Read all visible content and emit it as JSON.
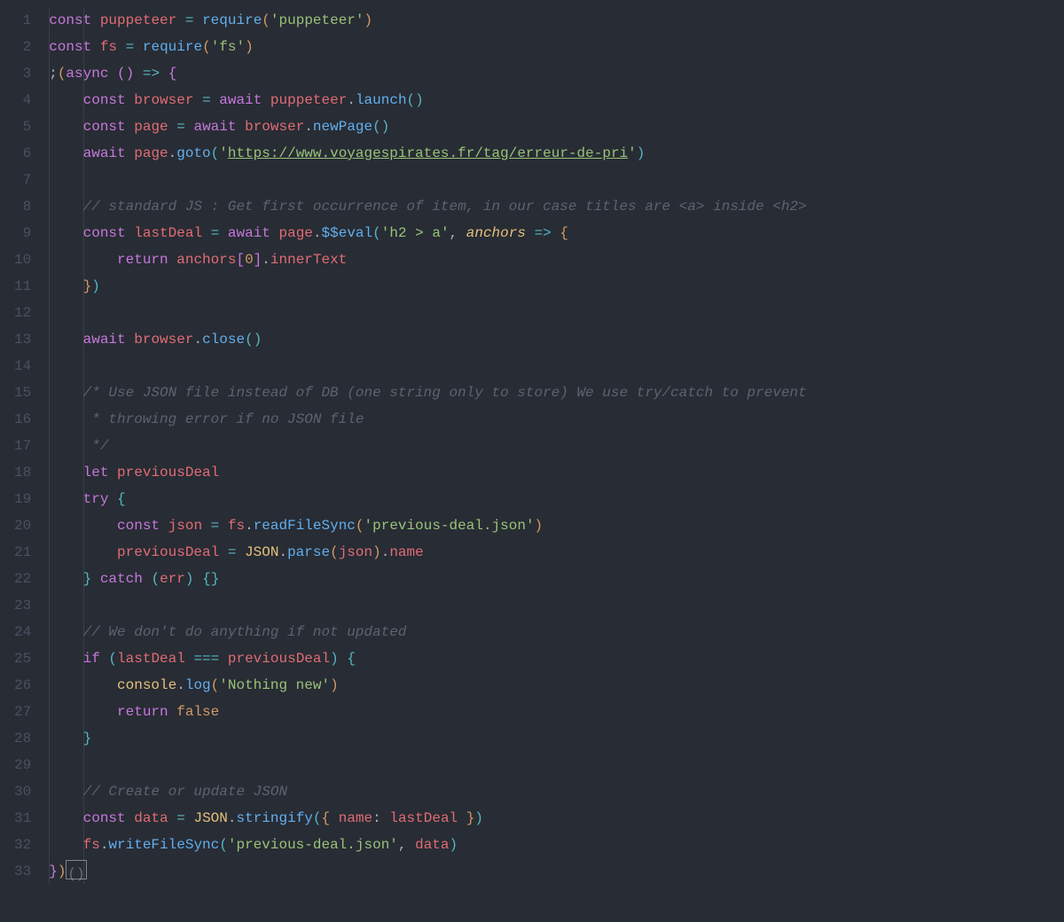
{
  "language": "javascript",
  "theme": "one-dark",
  "lineCount": 33,
  "tokens": {
    "l1": [
      [
        "kw",
        "const"
      ],
      [
        "pun",
        " "
      ],
      [
        "var",
        "puppeteer"
      ],
      [
        "pun",
        " "
      ],
      [
        "op",
        "="
      ],
      [
        "pun",
        " "
      ],
      [
        "fn",
        "require"
      ],
      [
        "brk1",
        "("
      ],
      [
        "str",
        "'puppeteer'"
      ],
      [
        "brk1",
        ")"
      ]
    ],
    "l2": [
      [
        "kw",
        "const"
      ],
      [
        "pun",
        " "
      ],
      [
        "var",
        "fs"
      ],
      [
        "pun",
        " "
      ],
      [
        "op",
        "="
      ],
      [
        "pun",
        " "
      ],
      [
        "fn",
        "require"
      ],
      [
        "brk1",
        "("
      ],
      [
        "str",
        "'fs'"
      ],
      [
        "brk1",
        ")"
      ]
    ],
    "l3": [
      [
        "pun",
        ";"
      ],
      [
        "brk1",
        "("
      ],
      [
        "kw",
        "async"
      ],
      [
        "pun",
        " "
      ],
      [
        "brk2",
        "("
      ],
      [
        "brk2",
        ")"
      ],
      [
        "pun",
        " "
      ],
      [
        "op",
        "=>"
      ],
      [
        "pun",
        " "
      ],
      [
        "brk2",
        "{"
      ]
    ],
    "l4": [
      [
        "pun",
        "    "
      ],
      [
        "kw",
        "const"
      ],
      [
        "pun",
        " "
      ],
      [
        "var",
        "browser"
      ],
      [
        "pun",
        " "
      ],
      [
        "op",
        "="
      ],
      [
        "pun",
        " "
      ],
      [
        "kw",
        "await"
      ],
      [
        "pun",
        " "
      ],
      [
        "var",
        "puppeteer"
      ],
      [
        "pun",
        "."
      ],
      [
        "fn",
        "launch"
      ],
      [
        "brk3",
        "("
      ],
      [
        "brk3",
        ")"
      ]
    ],
    "l5": [
      [
        "pun",
        "    "
      ],
      [
        "kw",
        "const"
      ],
      [
        "pun",
        " "
      ],
      [
        "var",
        "page"
      ],
      [
        "pun",
        " "
      ],
      [
        "op",
        "="
      ],
      [
        "pun",
        " "
      ],
      [
        "kw",
        "await"
      ],
      [
        "pun",
        " "
      ],
      [
        "var",
        "browser"
      ],
      [
        "pun",
        "."
      ],
      [
        "fn",
        "newPage"
      ],
      [
        "brk3",
        "("
      ],
      [
        "brk3",
        ")"
      ]
    ],
    "l6": [
      [
        "pun",
        "    "
      ],
      [
        "kw",
        "await"
      ],
      [
        "pun",
        " "
      ],
      [
        "var",
        "page"
      ],
      [
        "pun",
        "."
      ],
      [
        "fn",
        "goto"
      ],
      [
        "brk3",
        "("
      ],
      [
        "str",
        "'"
      ],
      [
        "link",
        "https://www.voyagespirates.fr/tag/erreur-de-pri"
      ],
      [
        "str",
        "'"
      ],
      [
        "brk3",
        ")"
      ]
    ],
    "l7": [],
    "l8": [
      [
        "pun",
        "    "
      ],
      [
        "cmt",
        "// standard JS : Get first occurrence of item, in our case titles are <a> inside <h2>"
      ]
    ],
    "l9": [
      [
        "pun",
        "    "
      ],
      [
        "kw",
        "const"
      ],
      [
        "pun",
        " "
      ],
      [
        "var",
        "lastDeal"
      ],
      [
        "pun",
        " "
      ],
      [
        "op",
        "="
      ],
      [
        "pun",
        " "
      ],
      [
        "kw",
        "await"
      ],
      [
        "pun",
        " "
      ],
      [
        "var",
        "page"
      ],
      [
        "pun",
        "."
      ],
      [
        "fn",
        "$$eval"
      ],
      [
        "brk3",
        "("
      ],
      [
        "str",
        "'h2 > a'"
      ],
      [
        "pun",
        ", "
      ],
      [
        "prm",
        "anchors"
      ],
      [
        "pun",
        " "
      ],
      [
        "op",
        "=>"
      ],
      [
        "pun",
        " "
      ],
      [
        "brk1",
        "{"
      ]
    ],
    "l10": [
      [
        "pun",
        "        "
      ],
      [
        "kw",
        "return"
      ],
      [
        "pun",
        " "
      ],
      [
        "var",
        "anchors"
      ],
      [
        "brk2",
        "["
      ],
      [
        "num",
        "0"
      ],
      [
        "brk2",
        "]"
      ],
      [
        "pun",
        "."
      ],
      [
        "prop",
        "innerText"
      ]
    ],
    "l11": [
      [
        "pun",
        "    "
      ],
      [
        "brk1",
        "}"
      ],
      [
        "brk3",
        ")"
      ]
    ],
    "l12": [],
    "l13": [
      [
        "pun",
        "    "
      ],
      [
        "kw",
        "await"
      ],
      [
        "pun",
        " "
      ],
      [
        "var",
        "browser"
      ],
      [
        "pun",
        "."
      ],
      [
        "fn",
        "close"
      ],
      [
        "brk3",
        "("
      ],
      [
        "brk3",
        ")"
      ]
    ],
    "l14": [],
    "l15": [
      [
        "pun",
        "    "
      ],
      [
        "cmt",
        "/* Use JSON file instead of DB (one string only to store) We use try/catch to prevent"
      ]
    ],
    "l16": [
      [
        "pun",
        "    "
      ],
      [
        "cmt",
        " * throwing error if no JSON file"
      ]
    ],
    "l17": [
      [
        "pun",
        "    "
      ],
      [
        "cmt",
        " */"
      ]
    ],
    "l18": [
      [
        "pun",
        "    "
      ],
      [
        "kw",
        "let"
      ],
      [
        "pun",
        " "
      ],
      [
        "var",
        "previousDeal"
      ]
    ],
    "l19": [
      [
        "pun",
        "    "
      ],
      [
        "kw",
        "try"
      ],
      [
        "pun",
        " "
      ],
      [
        "brk3",
        "{"
      ]
    ],
    "l20": [
      [
        "pun",
        "        "
      ],
      [
        "kw",
        "const"
      ],
      [
        "pun",
        " "
      ],
      [
        "var",
        "json"
      ],
      [
        "pun",
        " "
      ],
      [
        "op",
        "="
      ],
      [
        "pun",
        " "
      ],
      [
        "var",
        "fs"
      ],
      [
        "pun",
        "."
      ],
      [
        "fn",
        "readFileSync"
      ],
      [
        "brk1",
        "("
      ],
      [
        "str",
        "'previous-deal.json'"
      ],
      [
        "brk1",
        ")"
      ]
    ],
    "l21": [
      [
        "pun",
        "        "
      ],
      [
        "var",
        "previousDeal"
      ],
      [
        "pun",
        " "
      ],
      [
        "op",
        "="
      ],
      [
        "pun",
        " "
      ],
      [
        "obj",
        "JSON"
      ],
      [
        "pun",
        "."
      ],
      [
        "fn",
        "parse"
      ],
      [
        "brk1",
        "("
      ],
      [
        "var",
        "json"
      ],
      [
        "brk1",
        ")"
      ],
      [
        "pun",
        "."
      ],
      [
        "prop",
        "name"
      ]
    ],
    "l22": [
      [
        "pun",
        "    "
      ],
      [
        "brk3",
        "}"
      ],
      [
        "pun",
        " "
      ],
      [
        "kw",
        "catch"
      ],
      [
        "pun",
        " "
      ],
      [
        "brk3",
        "("
      ],
      [
        "var",
        "err"
      ],
      [
        "brk3",
        ")"
      ],
      [
        "pun",
        " "
      ],
      [
        "brk3",
        "{"
      ],
      [
        "brk3",
        "}"
      ]
    ],
    "l23": [],
    "l24": [
      [
        "pun",
        "    "
      ],
      [
        "cmt",
        "// We don't do anything if not updated"
      ]
    ],
    "l25": [
      [
        "pun",
        "    "
      ],
      [
        "kw",
        "if"
      ],
      [
        "pun",
        " "
      ],
      [
        "brk3",
        "("
      ],
      [
        "var",
        "lastDeal"
      ],
      [
        "pun",
        " "
      ],
      [
        "op",
        "==="
      ],
      [
        "pun",
        " "
      ],
      [
        "var",
        "previousDeal"
      ],
      [
        "brk3",
        ")"
      ],
      [
        "pun",
        " "
      ],
      [
        "brk3",
        "{"
      ]
    ],
    "l26": [
      [
        "pun",
        "        "
      ],
      [
        "obj",
        "console"
      ],
      [
        "pun",
        "."
      ],
      [
        "fn",
        "log"
      ],
      [
        "brk1",
        "("
      ],
      [
        "str",
        "'Nothing new'"
      ],
      [
        "brk1",
        ")"
      ]
    ],
    "l27": [
      [
        "pun",
        "        "
      ],
      [
        "kw",
        "return"
      ],
      [
        "pun",
        " "
      ],
      [
        "false",
        "false"
      ]
    ],
    "l28": [
      [
        "pun",
        "    "
      ],
      [
        "brk3",
        "}"
      ]
    ],
    "l29": [],
    "l30": [
      [
        "pun",
        "    "
      ],
      [
        "cmt",
        "// Create or update JSON"
      ]
    ],
    "l31": [
      [
        "pun",
        "    "
      ],
      [
        "kw",
        "const"
      ],
      [
        "pun",
        " "
      ],
      [
        "var",
        "data"
      ],
      [
        "pun",
        " "
      ],
      [
        "op",
        "="
      ],
      [
        "pun",
        " "
      ],
      [
        "obj",
        "JSON"
      ],
      [
        "pun",
        "."
      ],
      [
        "fn",
        "stringify"
      ],
      [
        "brk3",
        "("
      ],
      [
        "brk1",
        "{"
      ],
      [
        "pun",
        " "
      ],
      [
        "prop",
        "name"
      ],
      [
        "pun",
        ": "
      ],
      [
        "var",
        "lastDeal"
      ],
      [
        "pun",
        " "
      ],
      [
        "brk1",
        "}"
      ],
      [
        "brk3",
        ")"
      ]
    ],
    "l32": [
      [
        "pun",
        "    "
      ],
      [
        "var",
        "fs"
      ],
      [
        "pun",
        "."
      ],
      [
        "fn",
        "writeFileSync"
      ],
      [
        "brk3",
        "("
      ],
      [
        "str",
        "'previous-deal.json'"
      ],
      [
        "pun",
        ", "
      ],
      [
        "var",
        "data"
      ],
      [
        "brk3",
        ")"
      ]
    ],
    "l33": [
      [
        "brk2",
        "}"
      ],
      [
        "brk1",
        ")"
      ],
      [
        "cursor",
        "()"
      ]
    ]
  },
  "indentGuideColumns": [
    0,
    4
  ],
  "cursorLine": 33
}
